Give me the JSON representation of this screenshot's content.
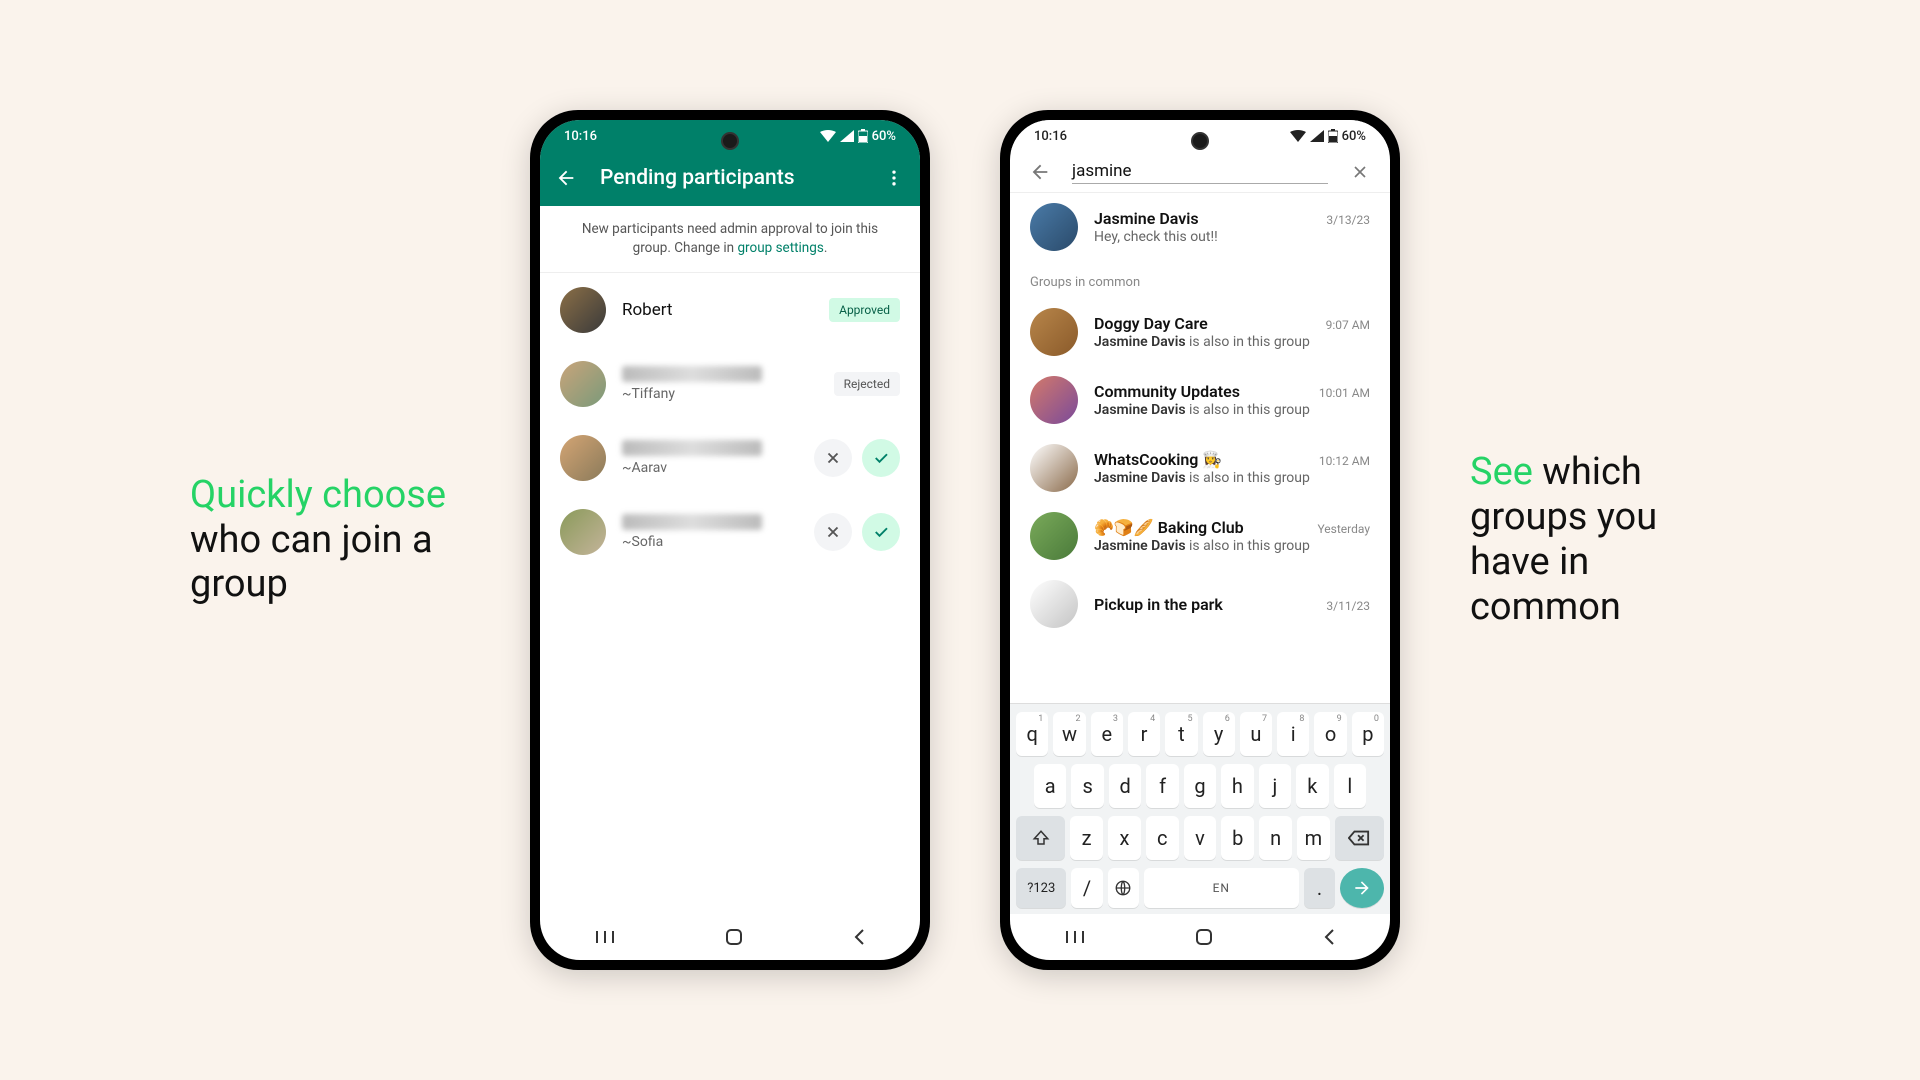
{
  "caption_left": {
    "highlight": "Quickly choose",
    "rest": " who can join a group"
  },
  "caption_right": {
    "highlight": "See",
    "rest": " which groups you have in common"
  },
  "status": {
    "time": "10:16",
    "battery": "60%"
  },
  "phone1": {
    "header_title": "Pending participants",
    "banner_text": "New participants need admin approval to join this group. Change in ",
    "banner_link": "group settings",
    "banner_dot": ".",
    "badges": {
      "approved": "Approved",
      "rejected": "Rejected"
    },
    "participants": [
      {
        "name": "Robert",
        "status": "approved",
        "avatar_bg": "linear-gradient(135deg,#8b6f47,#3a3a3a)"
      },
      {
        "subname": "~Tiffany",
        "status": "rejected",
        "avatar_bg": "linear-gradient(135deg,#c9a47a,#7a9a7a)"
      },
      {
        "subname": "~Aarav",
        "status": "pending",
        "avatar_bg": "linear-gradient(135deg,#d4a574,#8a7a5a)"
      },
      {
        "subname": "~Sofia",
        "status": "pending",
        "avatar_bg": "linear-gradient(135deg,#8a9a5a,#c4b49a)"
      }
    ]
  },
  "phone2": {
    "search_query": "jasmine",
    "section_label": "Groups in common",
    "chats": [
      {
        "title": "Jasmine Davis",
        "sub": "Hey, check this out!!",
        "time": "3/13/23",
        "avatar_bg": "linear-gradient(135deg,#4a7ba8,#2a4a6a)"
      }
    ],
    "group_sub_prefix": "Jasmine Davis",
    "group_sub_rest": " is also in this group",
    "groups": [
      {
        "title": "Doggy Day Care",
        "time": "9:07 AM",
        "avatar_bg": "linear-gradient(135deg,#b8864a,#8a5a2a)"
      },
      {
        "title": "Community Updates",
        "time": "10:01 AM",
        "avatar_bg": "linear-gradient(135deg,#d47a6a,#7a4a9a)"
      },
      {
        "title": "WhatsCooking 👩‍🍳",
        "time": "10:12 AM",
        "avatar_bg": "linear-gradient(135deg,#ffffff,#8a6a4a)"
      },
      {
        "title": "🥐🍞🥖 Baking Club",
        "time": "Yesterday",
        "avatar_bg": "linear-gradient(135deg,#7aaa5a,#4a7a3a)"
      },
      {
        "title": "Pickup in the park",
        "time": "3/11/23",
        "avatar_bg": "linear-gradient(135deg,#ffffff,#c4c4c4)"
      }
    ]
  },
  "keyboard": {
    "row1": [
      {
        "k": "q",
        "n": "1"
      },
      {
        "k": "w",
        "n": "2"
      },
      {
        "k": "e",
        "n": "3"
      },
      {
        "k": "r",
        "n": "4"
      },
      {
        "k": "t",
        "n": "5"
      },
      {
        "k": "y",
        "n": "6"
      },
      {
        "k": "u",
        "n": "7"
      },
      {
        "k": "i",
        "n": "8"
      },
      {
        "k": "o",
        "n": "9"
      },
      {
        "k": "p",
        "n": "0"
      }
    ],
    "row2": [
      "a",
      "s",
      "d",
      "f",
      "g",
      "h",
      "j",
      "k",
      "l"
    ],
    "row3": [
      "z",
      "x",
      "c",
      "v",
      "b",
      "n",
      "m"
    ],
    "sym": "?123",
    "slash": "/",
    "space_label": "EN",
    "dot": "."
  }
}
